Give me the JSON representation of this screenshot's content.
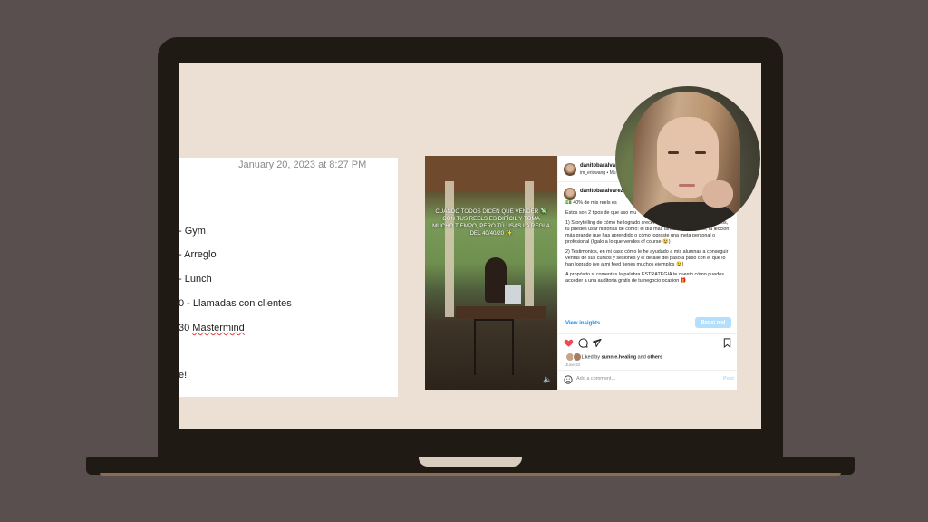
{
  "notes": {
    "date": "January 20, 2023 at 8:27 PM",
    "lines": [
      "- Gym",
      " - Arreglo",
      " - Lunch",
      "0 - Llamadas con clientes",
      "30 Mastermind",
      "e!"
    ]
  },
  "instagram": {
    "overlay_text": "Cuando todos dicen que vender 💸 con tus reels es difícil y toma mucho tiempo, pero tú usas la regla del 40/40/20 ✨",
    "header_user": "danitobaralvarez",
    "header_sub": "im_ericwang • Mu",
    "caption_user": "danitobaralvarez",
    "caption_paragraphs": [
      "💵 40% de mis reels es",
      "Estos son 2 tipos de que uso mu",
      "1) Storytelling de cómo he logrado crecer mi negocio de 6 cifras en 4 años, tu puedes usar historias de cómo: el día más difícil en tu negocio, la lección más grande que has aprendido o cómo lograste una meta personal o profesional (ligalo a lo que vendes of course 😉)",
      "2) Testimonios, en mi caso cómo le he ayudado a mis alumnas a conseguir ventas de sus cursos y sesiones y el detalle del paso a paso con el que lo han logrado (ve a mi feed tienes muchos ejemplos 😉)",
      "A propósito si comentas la palabra ESTRATEGIA te cuento cómo puedes acceder a una auditoría gratis de tu negocio ocasion 🎁"
    ],
    "view_insights": "View insights",
    "boost": "Boost reel",
    "liked_by_prefix": "Liked by ",
    "liked_by_user": "sunnie.healing",
    "liked_by_and": " and ",
    "liked_by_others": "others",
    "post_date": "June 22",
    "add_comment_placeholder": "Add a comment...",
    "post_label": "Post",
    "colors": {
      "link": "#0095f6",
      "like": "#ed4956",
      "boost": "#b2dffc"
    }
  },
  "icons": [
    "heart-icon",
    "comment-icon",
    "share-icon",
    "bookmark-icon",
    "emoji-icon",
    "sound-icon"
  ]
}
